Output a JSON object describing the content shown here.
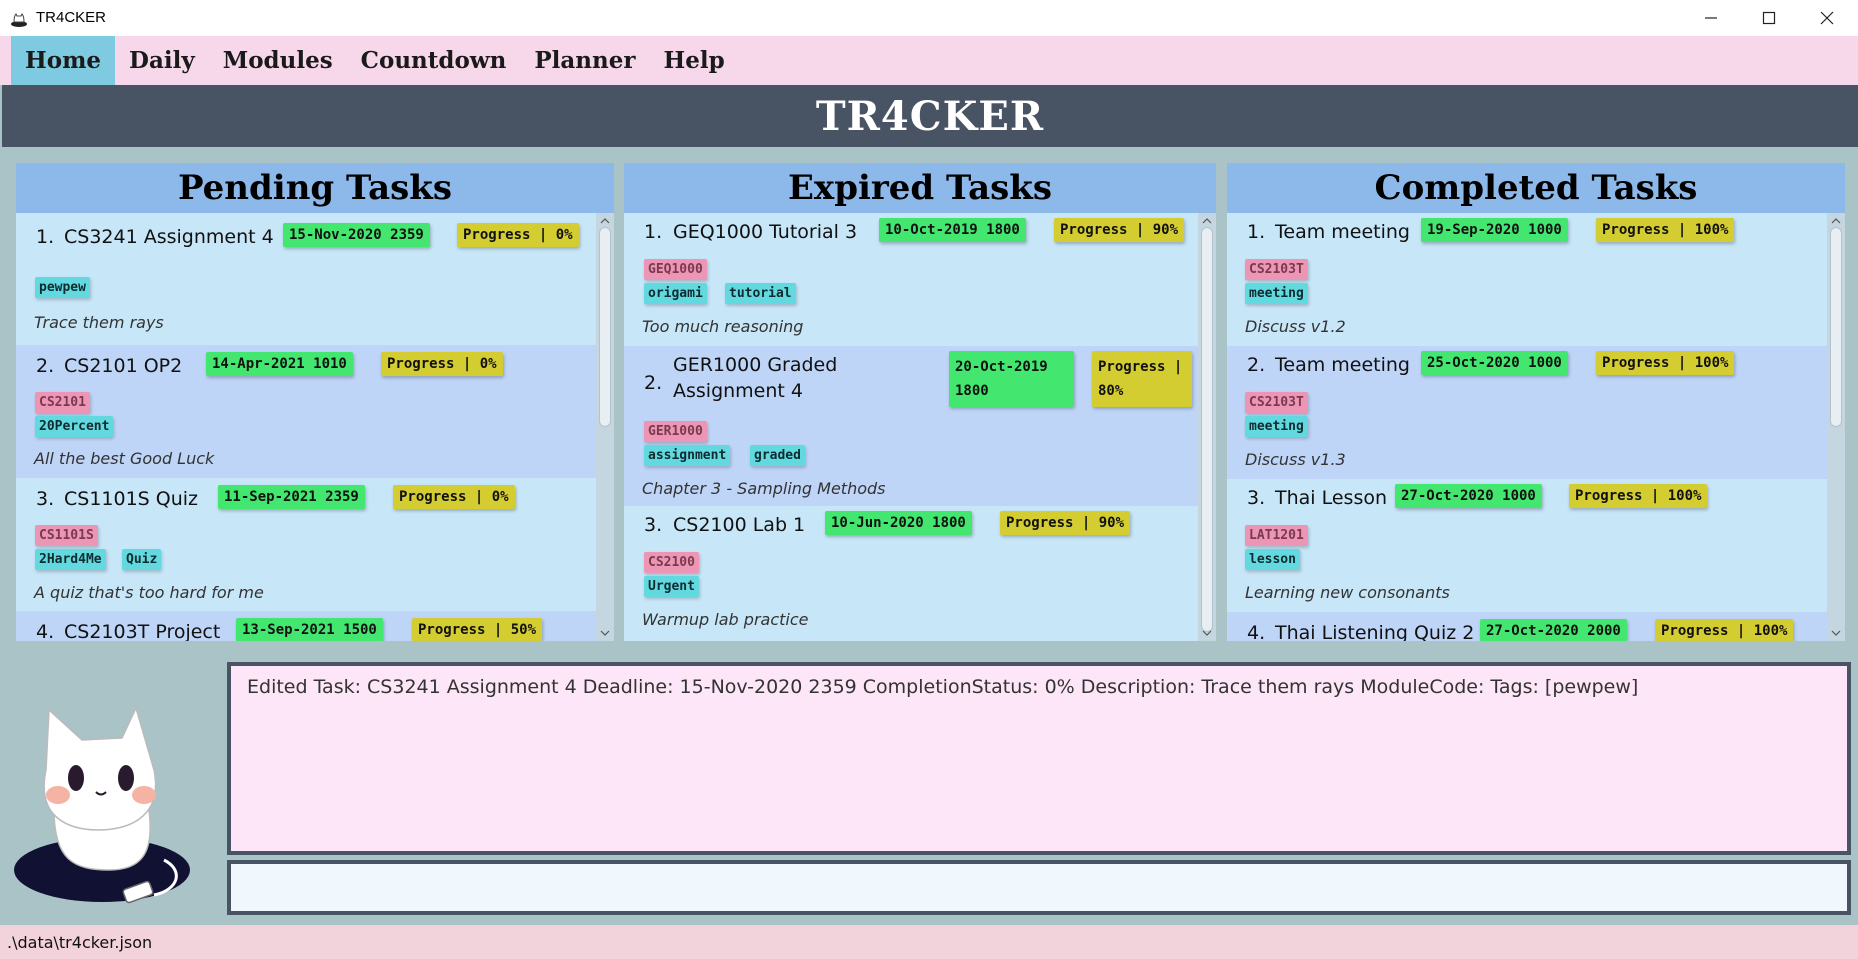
{
  "window": {
    "title": "TR4CKER"
  },
  "menu": [
    "Home",
    "Daily",
    "Modules",
    "Countdown",
    "Planner",
    "Help"
  ],
  "header": {
    "title": "TR4CKER"
  },
  "panels": {
    "pending": {
      "title": "Pending Tasks",
      "tasks": [
        {
          "num": "1.",
          "name": "CS3241 Assignment 4",
          "deadline": "15-Nov-2020 2359",
          "progress": "Progress | 0%",
          "module": "",
          "tags": [
            "pewpew"
          ],
          "description": "Trace them rays"
        },
        {
          "num": "2.",
          "name": "CS2101 OP2",
          "deadline": "14-Apr-2021 1010",
          "progress": "Progress | 0%",
          "module": "CS2101",
          "tags": [
            "20Percent"
          ],
          "description": "All the best Good Luck"
        },
        {
          "num": "3.",
          "name": "CS1101S Quiz",
          "deadline": "11-Sep-2021 2359",
          "progress": "Progress | 0%",
          "module": "CS1101S",
          "tags": [
            "2Hard4Me",
            "Quiz"
          ],
          "description": "A quiz that's too hard for me"
        },
        {
          "num": "4.",
          "name": "CS2103T Project",
          "deadline": "13-Sep-2021 1500",
          "progress": "Progress | 50%",
          "module": "",
          "tags": [],
          "description": ""
        }
      ]
    },
    "expired": {
      "title": "Expired Tasks",
      "tasks": [
        {
          "num": "1.",
          "name": "GEQ1000 Tutorial 3",
          "deadline": "10-Oct-2019 1800",
          "progress": "Progress | 90%",
          "module": "GEQ1000",
          "tags": [
            "origami",
            "tutorial"
          ],
          "description": "Too much reasoning"
        },
        {
          "num": "2.",
          "name": "GER1000 Graded Assignment 4",
          "deadline": "20-Oct-2019 1800",
          "progress": "Progress | 80%",
          "module": "GER1000",
          "tags": [
            "assignment",
            "graded"
          ],
          "description": "Chapter 3 - Sampling Methods"
        },
        {
          "num": "3.",
          "name": "CS2100 Lab 1",
          "deadline": "10-Jun-2020 1800",
          "progress": "Progress | 90%",
          "module": "CS2100",
          "tags": [
            "Urgent"
          ],
          "description": "Warmup lab practice"
        }
      ]
    },
    "completed": {
      "title": "Completed Tasks",
      "tasks": [
        {
          "num": "1.",
          "name": "Team meeting",
          "deadline": "19-Sep-2020 1000",
          "progress": "Progress | 100%",
          "module": "CS2103T",
          "tags": [
            "meeting"
          ],
          "description": "Discuss v1.2"
        },
        {
          "num": "2.",
          "name": "Team meeting",
          "deadline": "25-Oct-2020 1000",
          "progress": "Progress | 100%",
          "module": "CS2103T",
          "tags": [
            "meeting"
          ],
          "description": "Discuss v1.3"
        },
        {
          "num": "3.",
          "name": "Thai Lesson",
          "deadline": "27-Oct-2020 1000",
          "progress": "Progress | 100%",
          "module": "LAT1201",
          "tags": [
            "lesson"
          ],
          "description": "Learning new consonants"
        },
        {
          "num": "4.",
          "name": "Thai Listening Quiz 2",
          "deadline": "27-Oct-2020 2000",
          "progress": "Progress | 100%",
          "module": "",
          "tags": [],
          "description": ""
        }
      ]
    }
  },
  "result": {
    "text": "Edited Task: CS3241 Assignment 4 Deadline: 15-Nov-2020 2359 CompletionStatus: 0% Description: Trace them rays ModuleCode:  Tags: [pewpew]"
  },
  "command": {
    "value": "",
    "placeholder": ""
  },
  "status": {
    "path": ".\\data\\tr4cker.json"
  },
  "colors": {
    "menu_bg": "#f7d7ea",
    "menu_active": "#7ecae0",
    "header_bg": "#485363",
    "panel_head": "#8db8ea",
    "deadline_chip": "#43e66e",
    "progress_chip": "#d4cd31",
    "module_tag": "#ec95b5",
    "keyword_tag": "#62d9df",
    "result_bg": "#fde6f7",
    "status_bg": "#f3d3db"
  },
  "icons": [
    "app-cat-icon",
    "minimize-icon",
    "maximize-icon",
    "close-icon",
    "scroll-up-icon",
    "scroll-down-icon",
    "mascot-cat-icon"
  ]
}
